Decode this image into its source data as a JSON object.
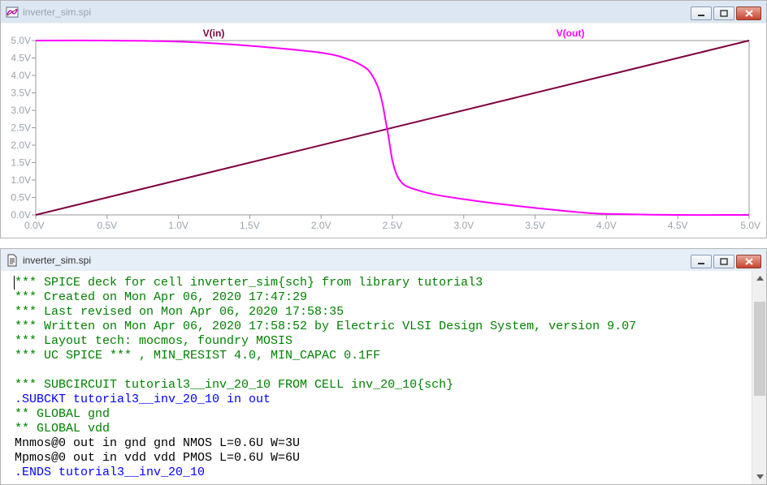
{
  "plot_window": {
    "title": "inverter_sim.spi",
    "icon": "waveform-icon",
    "controls": [
      "minimize-icon",
      "restore-icon",
      "close-icon"
    ]
  },
  "chart_data": {
    "type": "line",
    "title": "",
    "xlabel": "",
    "ylabel": "",
    "xlim": [
      0,
      5
    ],
    "ylim": [
      0,
      5
    ],
    "x_ticks": [
      "0.0V",
      "0.5V",
      "1.0V",
      "1.5V",
      "2.0V",
      "2.5V",
      "3.0V",
      "3.5V",
      "4.0V",
      "4.5V",
      "5.0V"
    ],
    "y_ticks": [
      "0.0V",
      "0.5V",
      "1.0V",
      "1.5V",
      "2.0V",
      "2.5V",
      "3.0V",
      "3.5V",
      "4.0V",
      "4.5V",
      "5.0V"
    ],
    "grid": false,
    "legend_placement": "top",
    "series": [
      {
        "name": "V(in)",
        "color": "#800040",
        "x": [
          0.0,
          5.0
        ],
        "y": [
          0.0,
          5.0
        ]
      },
      {
        "name": "V(out)",
        "color": "#ff00ff",
        "x": [
          0.0,
          0.5,
          1.0,
          1.5,
          2.0,
          2.2,
          2.3,
          2.35,
          2.4,
          2.43,
          2.45,
          2.47,
          2.5,
          2.53,
          2.56,
          2.6,
          2.7,
          2.8,
          3.0,
          3.2,
          3.5,
          3.8,
          4.0,
          4.5,
          5.0
        ],
        "y": [
          5.0,
          5.0,
          4.97,
          4.85,
          4.65,
          4.45,
          4.25,
          4.05,
          3.65,
          3.2,
          2.75,
          2.3,
          1.55,
          1.15,
          0.95,
          0.82,
          0.68,
          0.58,
          0.45,
          0.34,
          0.2,
          0.08,
          0.03,
          0.0,
          0.0
        ]
      }
    ]
  },
  "text_window": {
    "title": "inverter_sim.spi",
    "icon": "document-icon",
    "controls": [
      "minimize-icon",
      "restore-icon",
      "close-icon"
    ],
    "colors": {
      "comment": "#008000",
      "directive": "#0000ff",
      "plain": "#000000"
    },
    "lines": [
      {
        "text": "*** SPICE deck for cell inverter_sim{sch} from library tutorial3",
        "kind": "comment"
      },
      {
        "text": "*** Created on Mon Apr 06, 2020 17:47:29",
        "kind": "comment"
      },
      {
        "text": "*** Last revised on Mon Apr 06, 2020 17:58:35",
        "kind": "comment"
      },
      {
        "text": "*** Written on Mon Apr 06, 2020 17:58:52 by Electric VLSI Design System, version 9.07",
        "kind": "comment"
      },
      {
        "text": "*** Layout tech: mocmos, foundry MOSIS",
        "kind": "comment"
      },
      {
        "text": "*** UC SPICE *** , MIN_RESIST 4.0, MIN_CAPAC 0.1FF",
        "kind": "comment"
      },
      {
        "text": "",
        "kind": "plain"
      },
      {
        "text": "*** SUBCIRCUIT tutorial3__inv_20_10 FROM CELL inv_20_10{sch}",
        "kind": "comment"
      },
      {
        "text": ".SUBCKT tutorial3__inv_20_10 in out",
        "kind": "directive"
      },
      {
        "text": "** GLOBAL gnd",
        "kind": "comment"
      },
      {
        "text": "** GLOBAL vdd",
        "kind": "comment"
      },
      {
        "text": "Mnmos@0 out in gnd gnd NMOS L=0.6U W=3U",
        "kind": "plain"
      },
      {
        "text": "Mpmos@0 out in vdd vdd PMOS L=0.6U W=6U",
        "kind": "plain"
      },
      {
        "text": ".ENDS tutorial3__inv_20_10",
        "kind": "directive"
      }
    ]
  }
}
